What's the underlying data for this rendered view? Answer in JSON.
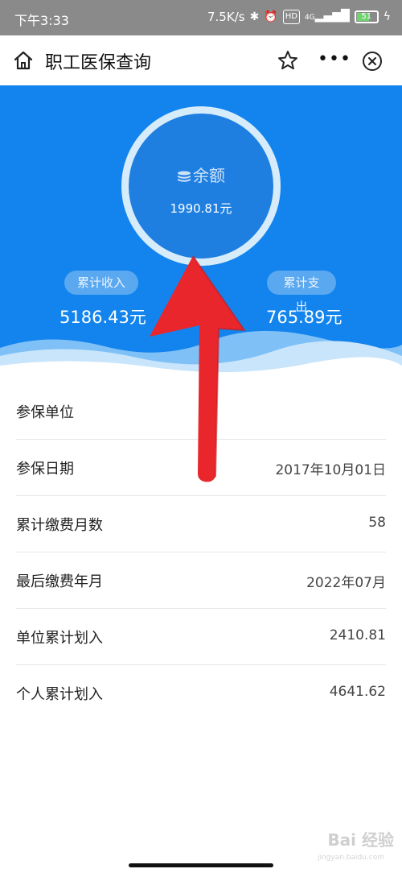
{
  "status_bar": {
    "time": "下午3:33",
    "network_speed": "7.5K/s",
    "hd_badge": "HD",
    "signal": "4G",
    "battery": "51"
  },
  "nav": {
    "title": "职工医保查询"
  },
  "balance": {
    "label": "余额",
    "value": "1990.81元"
  },
  "income": {
    "label": "累计收入",
    "value": "5186.43元"
  },
  "expense": {
    "label": "累计支出",
    "value": "765.89元"
  },
  "details": [
    {
      "label": "参保单位",
      "value": ""
    },
    {
      "label": "参保日期",
      "value": "2017年10月01日"
    },
    {
      "label": "累计缴费月数",
      "value": "58"
    },
    {
      "label": "最后缴费年月",
      "value": "2022年07月"
    },
    {
      "label": "单位累计划入",
      "value": "2410.81"
    },
    {
      "label": "个人累计划入",
      "value": "4641.62"
    }
  ],
  "watermark": {
    "brand": "Bai 经验",
    "url": "jingyan.baidu.com"
  },
  "colors": {
    "hero_blue": "#1384ee",
    "circle_blue": "#1e7fe0",
    "arrow_red": "#e8262b"
  }
}
